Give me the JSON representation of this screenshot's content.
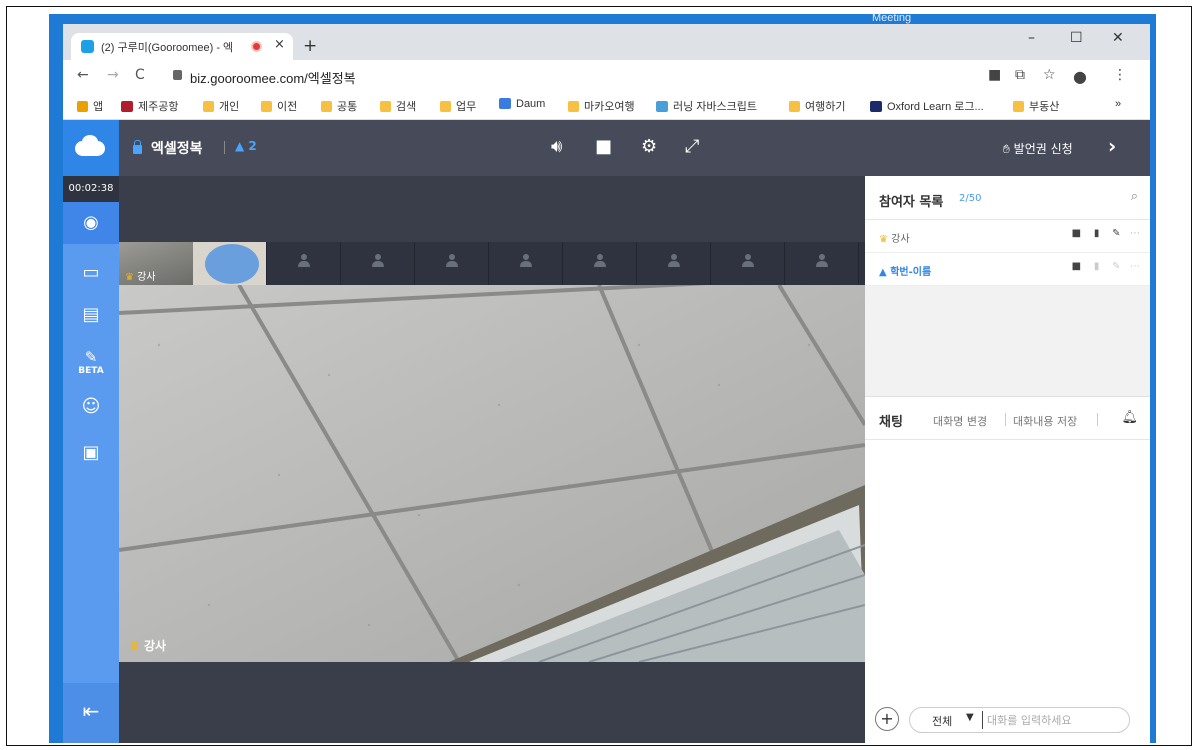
{
  "os": {
    "window_tag": "Meeting"
  },
  "browser": {
    "tab_title": "(2) 구루미(Gooroomee) - 엑",
    "tab_close": "×",
    "new_tab": "+",
    "window_minimize": "–",
    "window_maximize": "☐",
    "window_close": "✕",
    "url": "biz.gooroomee.com/엑셀정복",
    "bookmarks": [
      {
        "label": "앱",
        "icon": "apps-grid-icon"
      },
      {
        "label": "제주공항",
        "icon": "site-icon"
      },
      {
        "label": "개인",
        "icon": "folder-icon"
      },
      {
        "label": "이전",
        "icon": "folder-icon"
      },
      {
        "label": "공통",
        "icon": "folder-icon"
      },
      {
        "label": "검색",
        "icon": "folder-icon"
      },
      {
        "label": "업무",
        "icon": "folder-icon"
      },
      {
        "label": "Daum",
        "icon": "daum-icon"
      },
      {
        "label": "마카오여행",
        "icon": "folder-icon"
      },
      {
        "label": "러닝 자바스크립트",
        "icon": "site-icon"
      },
      {
        "label": "여행하기",
        "icon": "folder-icon"
      },
      {
        "label": "Oxford Learn 로그...",
        "icon": "oup-icon"
      },
      {
        "label": "부동산",
        "icon": "folder-icon"
      }
    ],
    "bookmarks_overflow": "»"
  },
  "app": {
    "room_title": "엑셀정복",
    "participant_count": "2",
    "speak_request_label": "발언권 신청",
    "timer": "00:02:38",
    "sidebar_beta_label": "BETA",
    "thumb_host_label": "강사",
    "main_video_label": "강사",
    "participants_panel": {
      "title": "참여자 목록",
      "count": "2/50",
      "participants": [
        {
          "name": "강사",
          "role": "host"
        },
        {
          "name": "학번-이름",
          "role": "user"
        }
      ]
    },
    "chat": {
      "title": "채팅",
      "rename_label": "대화명 변경",
      "save_label": "대화내용 저장",
      "scope_selected": "전체",
      "input_placeholder": "대화를 입력하세요"
    }
  },
  "colors": {
    "accent_blue": "#2f86e6",
    "sidebar_blue": "#5a9bf0",
    "topbar": "#474b59",
    "crown": "#f2b51d"
  }
}
